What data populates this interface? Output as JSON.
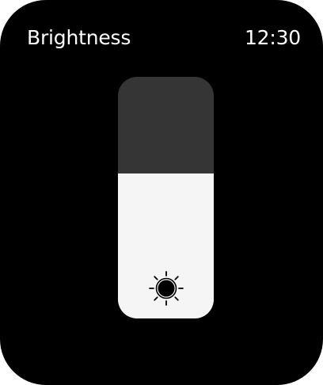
{
  "header": {
    "title": "Brightness",
    "time": "12:30"
  },
  "brightness": {
    "level": 0.6,
    "icon": "sun-icon"
  },
  "colors": {
    "background": "#000000",
    "slider_track": "#353535",
    "slider_fill": "#f5f5f5",
    "text": "#ffffff",
    "icon": "#000000"
  }
}
